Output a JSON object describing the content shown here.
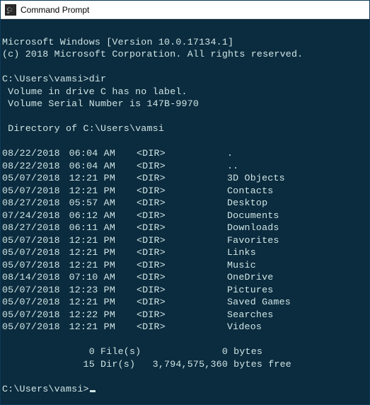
{
  "window": {
    "title": "Command Prompt"
  },
  "header": {
    "line1": "Microsoft Windows [Version 10.0.17134.1]",
    "line2": "(c) 2018 Microsoft Corporation. All rights reserved."
  },
  "prompt1": "C:\\Users\\vamsi>",
  "command1": "dir",
  "volume": {
    "line1": " Volume in drive C has no label.",
    "line2": " Volume Serial Number is 147B-9970"
  },
  "dirOf": " Directory of C:\\Users\\vamsi",
  "listing": [
    {
      "date": "08/22/2018",
      "time": "06:04 AM",
      "type": "<DIR>",
      "name": "."
    },
    {
      "date": "08/22/2018",
      "time": "06:04 AM",
      "type": "<DIR>",
      "name": ".."
    },
    {
      "date": "05/07/2018",
      "time": "12:21 PM",
      "type": "<DIR>",
      "name": "3D Objects"
    },
    {
      "date": "05/07/2018",
      "time": "12:21 PM",
      "type": "<DIR>",
      "name": "Contacts"
    },
    {
      "date": "08/27/2018",
      "time": "05:57 AM",
      "type": "<DIR>",
      "name": "Desktop"
    },
    {
      "date": "07/24/2018",
      "time": "06:12 AM",
      "type": "<DIR>",
      "name": "Documents"
    },
    {
      "date": "08/27/2018",
      "time": "06:11 AM",
      "type": "<DIR>",
      "name": "Downloads"
    },
    {
      "date": "05/07/2018",
      "time": "12:21 PM",
      "type": "<DIR>",
      "name": "Favorites"
    },
    {
      "date": "05/07/2018",
      "time": "12:21 PM",
      "type": "<DIR>",
      "name": "Links"
    },
    {
      "date": "05/07/2018",
      "time": "12:21 PM",
      "type": "<DIR>",
      "name": "Music"
    },
    {
      "date": "08/14/2018",
      "time": "07:10 AM",
      "type": "<DIR>",
      "name": "OneDrive"
    },
    {
      "date": "05/07/2018",
      "time": "12:23 PM",
      "type": "<DIR>",
      "name": "Pictures"
    },
    {
      "date": "05/07/2018",
      "time": "12:21 PM",
      "type": "<DIR>",
      "name": "Saved Games"
    },
    {
      "date": "05/07/2018",
      "time": "12:22 PM",
      "type": "<DIR>",
      "name": "Searches"
    },
    {
      "date": "05/07/2018",
      "time": "12:21 PM",
      "type": "<DIR>",
      "name": "Videos"
    }
  ],
  "summary": {
    "files": "               0 File(s)              0 bytes",
    "dirs": "              15 Dir(s)   3,794,575,360 bytes free"
  },
  "prompt2": "C:\\Users\\vamsi>"
}
